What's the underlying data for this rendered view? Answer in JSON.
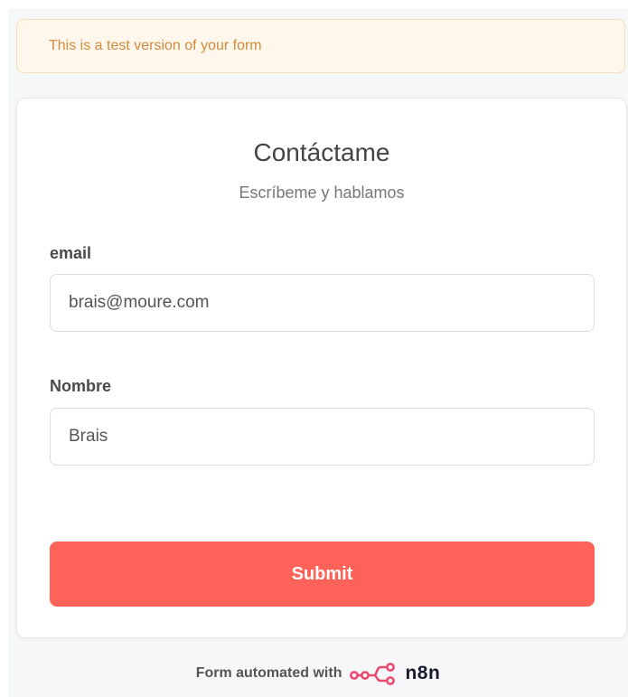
{
  "banner": {
    "text": "This is a test version of your form"
  },
  "form": {
    "title": "Contáctame",
    "subtitle": "Escríbeme y hablamos",
    "fields": [
      {
        "label": "email",
        "value": "brais@moure.com"
      },
      {
        "label": "Nombre",
        "value": "Brais"
      }
    ],
    "submit_label": "Submit"
  },
  "footer": {
    "text": "Form automated with",
    "brand": "n8n",
    "brand_icon": "n8n-logo-icon"
  },
  "colors": {
    "accent": "#ff6258",
    "banner_text": "#d38a3c",
    "banner_bg": "#fff7ec",
    "brand_logo": "#ea4b71"
  }
}
